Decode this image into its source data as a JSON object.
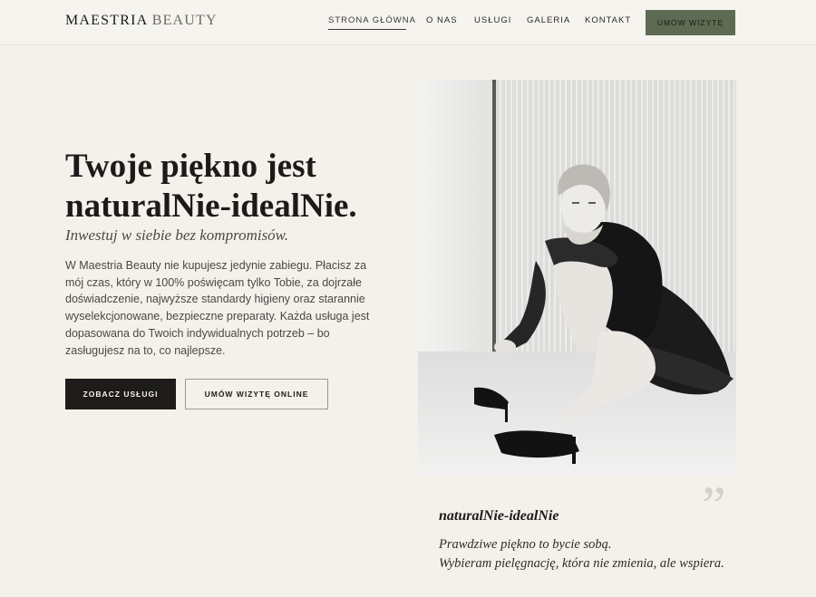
{
  "brand": {
    "name_part1": "MAESTRIA",
    "name_part2": "BEAUTY"
  },
  "nav": {
    "items": [
      {
        "label": "STRONA GŁÓWNA",
        "active": true
      },
      {
        "label": "O NAS"
      },
      {
        "label": "USŁUGI"
      },
      {
        "label": "GALERIA"
      },
      {
        "label": "KONTAKT"
      }
    ],
    "cta_label": "UMÓW WIZYTĘ"
  },
  "hero": {
    "title_line1": "Twoje piękno jest",
    "title_line2": "naturalNie-idealNie.",
    "subtitle": "Inwestuj w siebie bez kompromisów.",
    "body": "W Maestria Beauty nie kupujesz jedynie zabiegu. Płacisz za mój czas, który w 100% poświęcam tylko Tobie, za dojrzałe doświadczenie, najwyższe standardy higieny oraz starannie wyselekcjonowane, bezpieczne preparaty. Każda usługa jest dopasowana do Twoich indywidualnych potrzeb – bo zasługujesz na to, co najlepsze.",
    "primary_button": "ZOBACZ USŁUGI",
    "secondary_button": "UMÓW WIZYTĘ ONLINE"
  },
  "quote": {
    "mark": "”",
    "title": "naturalNie-idealNie",
    "line1": "Prawdziwe piękno to bycie sobą.",
    "line2": "Wybieram pielęgnację, która nie zmienia, ale wspiera."
  },
  "colors": {
    "background": "#f4f1eb",
    "accent_green": "#5d6b52",
    "dark": "#1d1c1a"
  }
}
